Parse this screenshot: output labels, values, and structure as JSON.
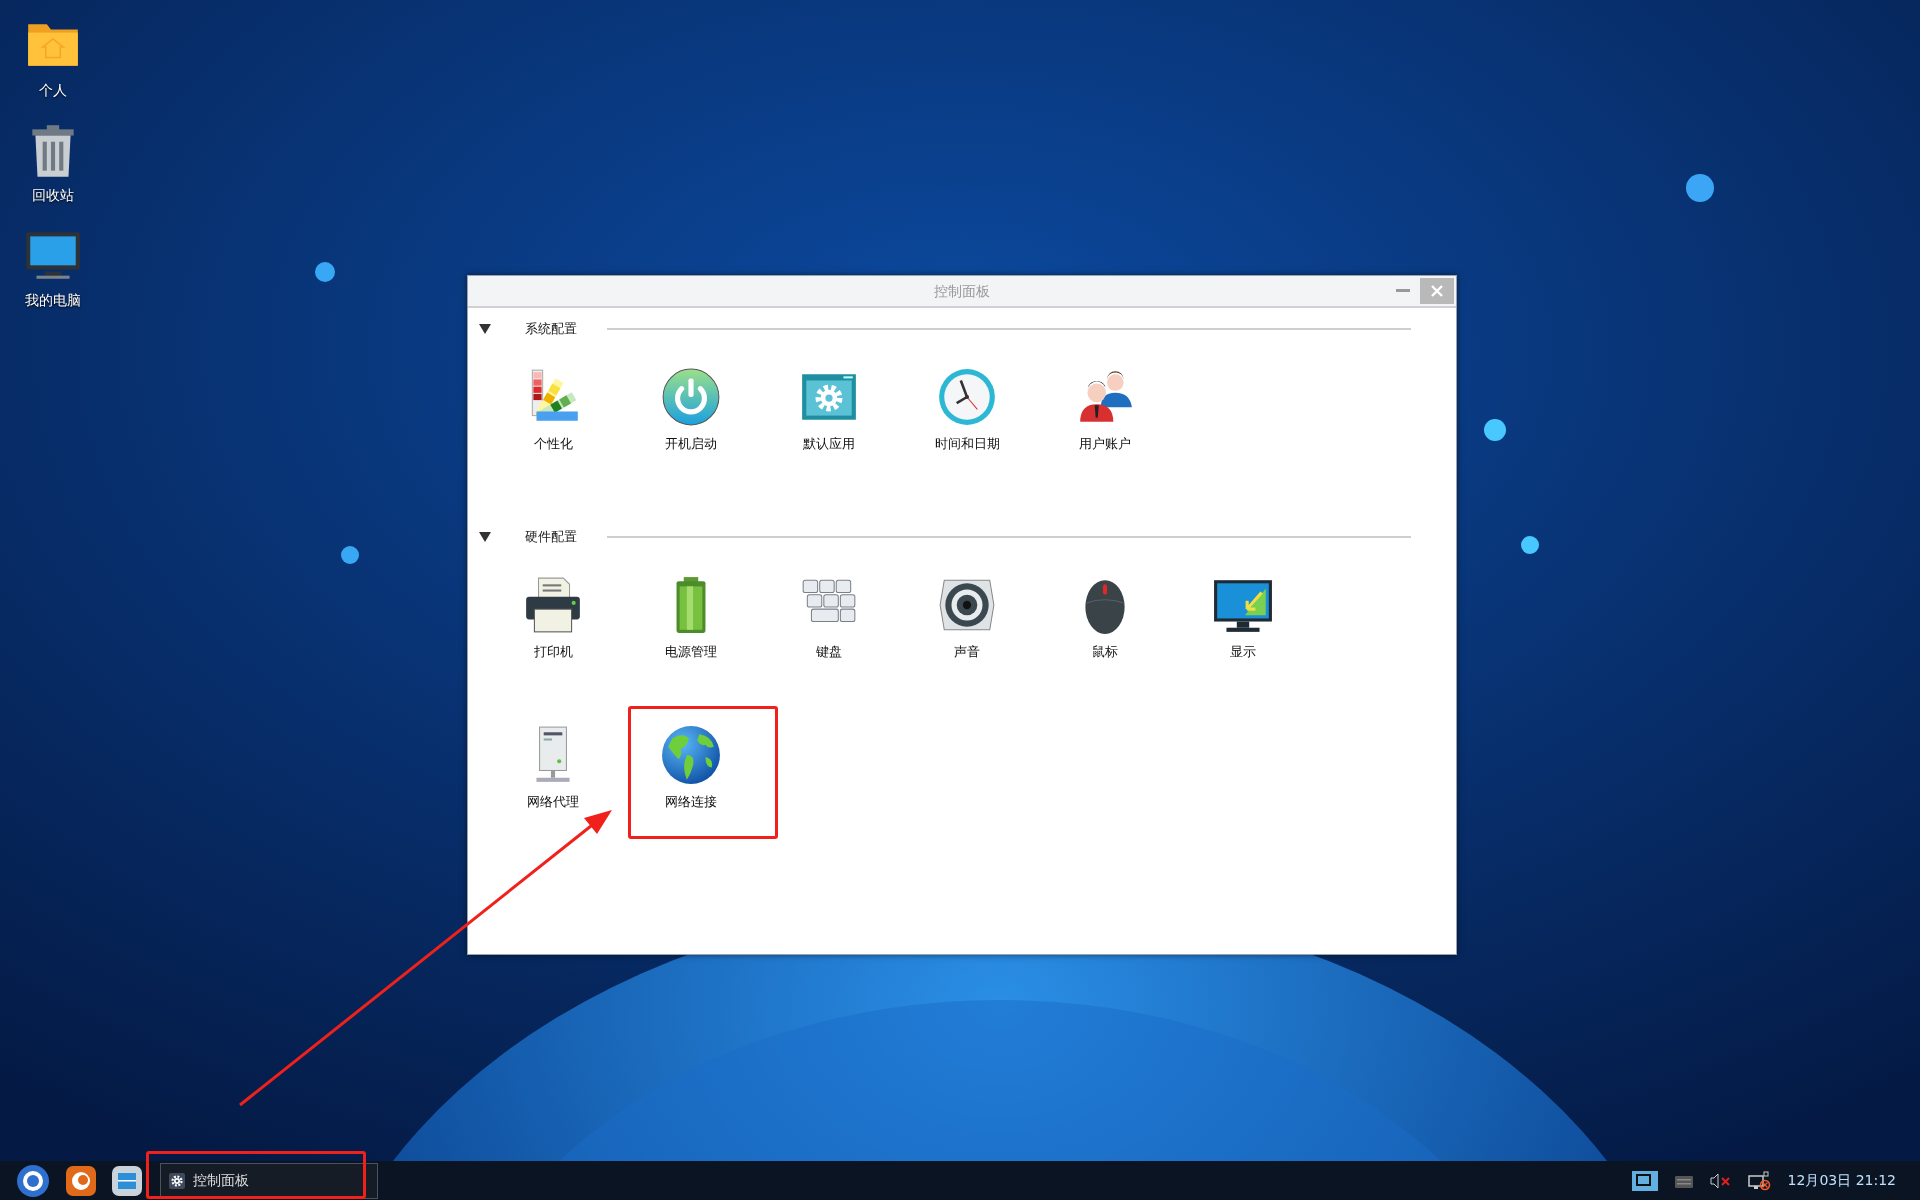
{
  "desktop_icons": [
    {
      "label": "个人"
    },
    {
      "label": "回收站"
    },
    {
      "label": "我的电脑"
    }
  ],
  "window": {
    "title": "控制面板",
    "sections": [
      {
        "title": "系统配置",
        "expanded": true,
        "items": [
          {
            "label": "个性化",
            "highlighted": false
          },
          {
            "label": "开机启动",
            "highlighted": false
          },
          {
            "label": "默认应用",
            "highlighted": false
          },
          {
            "label": "时间和日期",
            "highlighted": false
          },
          {
            "label": "用户账户",
            "highlighted": false
          }
        ]
      },
      {
        "title": "硬件配置",
        "expanded": true,
        "items": [
          {
            "label": "打印机",
            "highlighted": false
          },
          {
            "label": "电源管理",
            "highlighted": false
          },
          {
            "label": "键盘",
            "highlighted": false
          },
          {
            "label": "声音",
            "highlighted": false
          },
          {
            "label": "鼠标",
            "highlighted": false
          },
          {
            "label": "显示",
            "highlighted": false
          },
          {
            "label": "网络代理",
            "highlighted": false
          },
          {
            "label": "网络连接",
            "highlighted": true
          }
        ]
      }
    ]
  },
  "taskbar": {
    "tasks": [
      {
        "label": "控制面板",
        "highlighted": true
      }
    ],
    "clock": "12月03日 21:12"
  }
}
